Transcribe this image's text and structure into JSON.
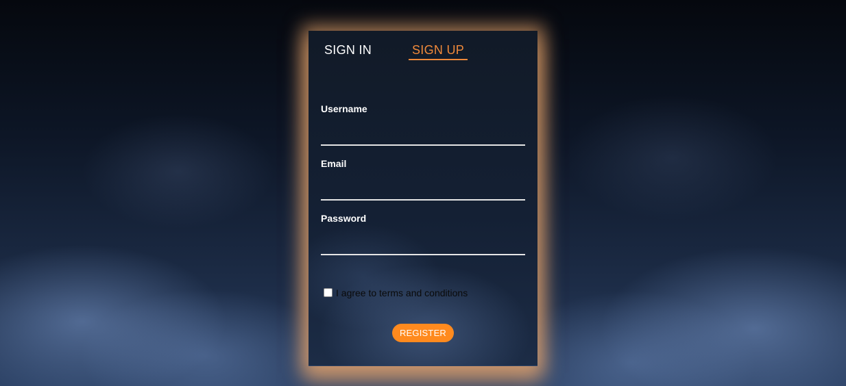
{
  "tabs": {
    "sign_in": "SIGN IN",
    "sign_up": "SIGN UP",
    "active": "sign_up"
  },
  "form": {
    "username_label": "Username",
    "username_value": "",
    "email_label": "Email",
    "email_value": "",
    "password_label": "Password",
    "password_value": "",
    "terms_label": "I agree to terms and conditions",
    "terms_checked": false,
    "register_label": "REGISTER"
  },
  "colors": {
    "accent": "#f0893a",
    "button": "#ff8a1e",
    "glow": "#f0aa6e",
    "card_bg": "#142034"
  }
}
